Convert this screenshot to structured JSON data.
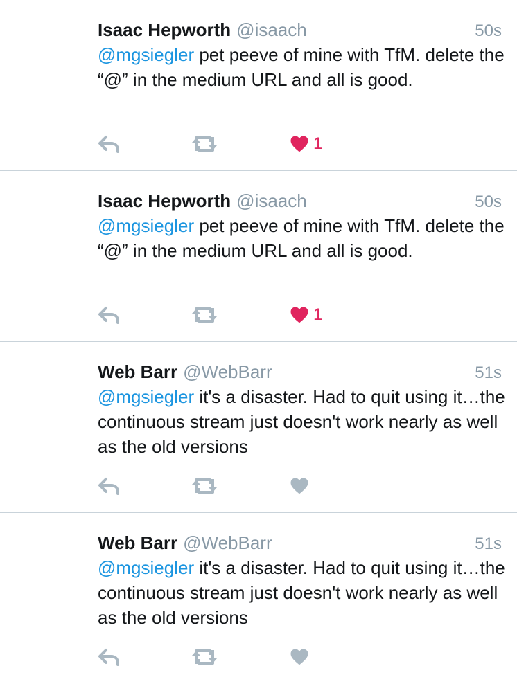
{
  "colors": {
    "text": "#14171a",
    "muted": "#8899a6",
    "link": "#1b95e0",
    "like_active": "#e0245e",
    "icon": "#aab8c2",
    "divider": "#c9d3da"
  },
  "tweets": [
    {
      "name": "Isaac Hepworth",
      "handle": "@isaach",
      "time": "50s",
      "mention": "@mgsiegler",
      "text": " pet peeve of mine with TfM. delete the “@” in the medium URL and all is good.",
      "liked": true,
      "like_count": "1",
      "icons": {
        "reply": "reply-icon",
        "retweet": "retweet-icon",
        "like": "heart-icon"
      }
    },
    {
      "name": "Isaac Hepworth",
      "handle": "@isaach",
      "time": "50s",
      "mention": "@mgsiegler",
      "text": " pet peeve of mine with TfM. delete the “@” in the medium URL and all is good.",
      "liked": true,
      "like_count": "1",
      "icons": {
        "reply": "reply-icon",
        "retweet": "retweet-icon",
        "like": "heart-icon"
      }
    },
    {
      "name": "Web Barr",
      "handle": "@WebBarr",
      "time": "51s",
      "mention": "@mgsiegler",
      "text": " it's a disaster. Had to quit using it…the continuous stream just doesn't work nearly as well as the old versions",
      "liked": false,
      "like_count": "",
      "icons": {
        "reply": "reply-icon",
        "retweet": "retweet-icon",
        "like": "heart-icon"
      }
    },
    {
      "name": "Web Barr",
      "handle": "@WebBarr",
      "time": "51s",
      "mention": "@mgsiegler",
      "text": " it's a disaster. Had to quit using it…the continuous stream just doesn't work nearly as well as the old versions",
      "liked": false,
      "like_count": "",
      "icons": {
        "reply": "reply-icon",
        "retweet": "retweet-icon",
        "like": "heart-icon"
      }
    }
  ]
}
